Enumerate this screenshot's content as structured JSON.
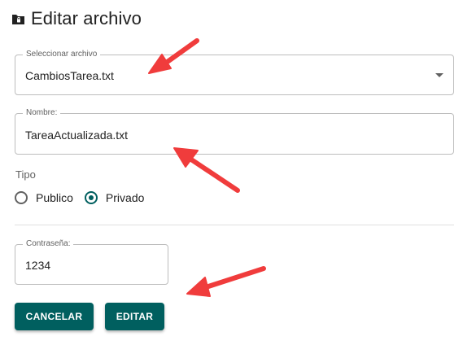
{
  "header": {
    "title": "Editar archivo",
    "icon": "folder-lock-icon"
  },
  "file_select": {
    "label": "Seleccionar archivo",
    "value": "CambiosTarea.txt"
  },
  "name_field": {
    "label": "Nombre:",
    "value": "TareaActualizada.txt"
  },
  "tipo": {
    "label": "Tipo",
    "options": [
      {
        "label": "Publico",
        "checked": false
      },
      {
        "label": "Privado",
        "checked": true
      }
    ]
  },
  "password_field": {
    "label": "Contraseña:",
    "value": "1234"
  },
  "buttons": {
    "cancel_label": "CANCELAR",
    "edit_label": "EDITAR"
  },
  "colors": {
    "primary": "#005f5f",
    "annotation_arrow": "#f03c3c"
  }
}
